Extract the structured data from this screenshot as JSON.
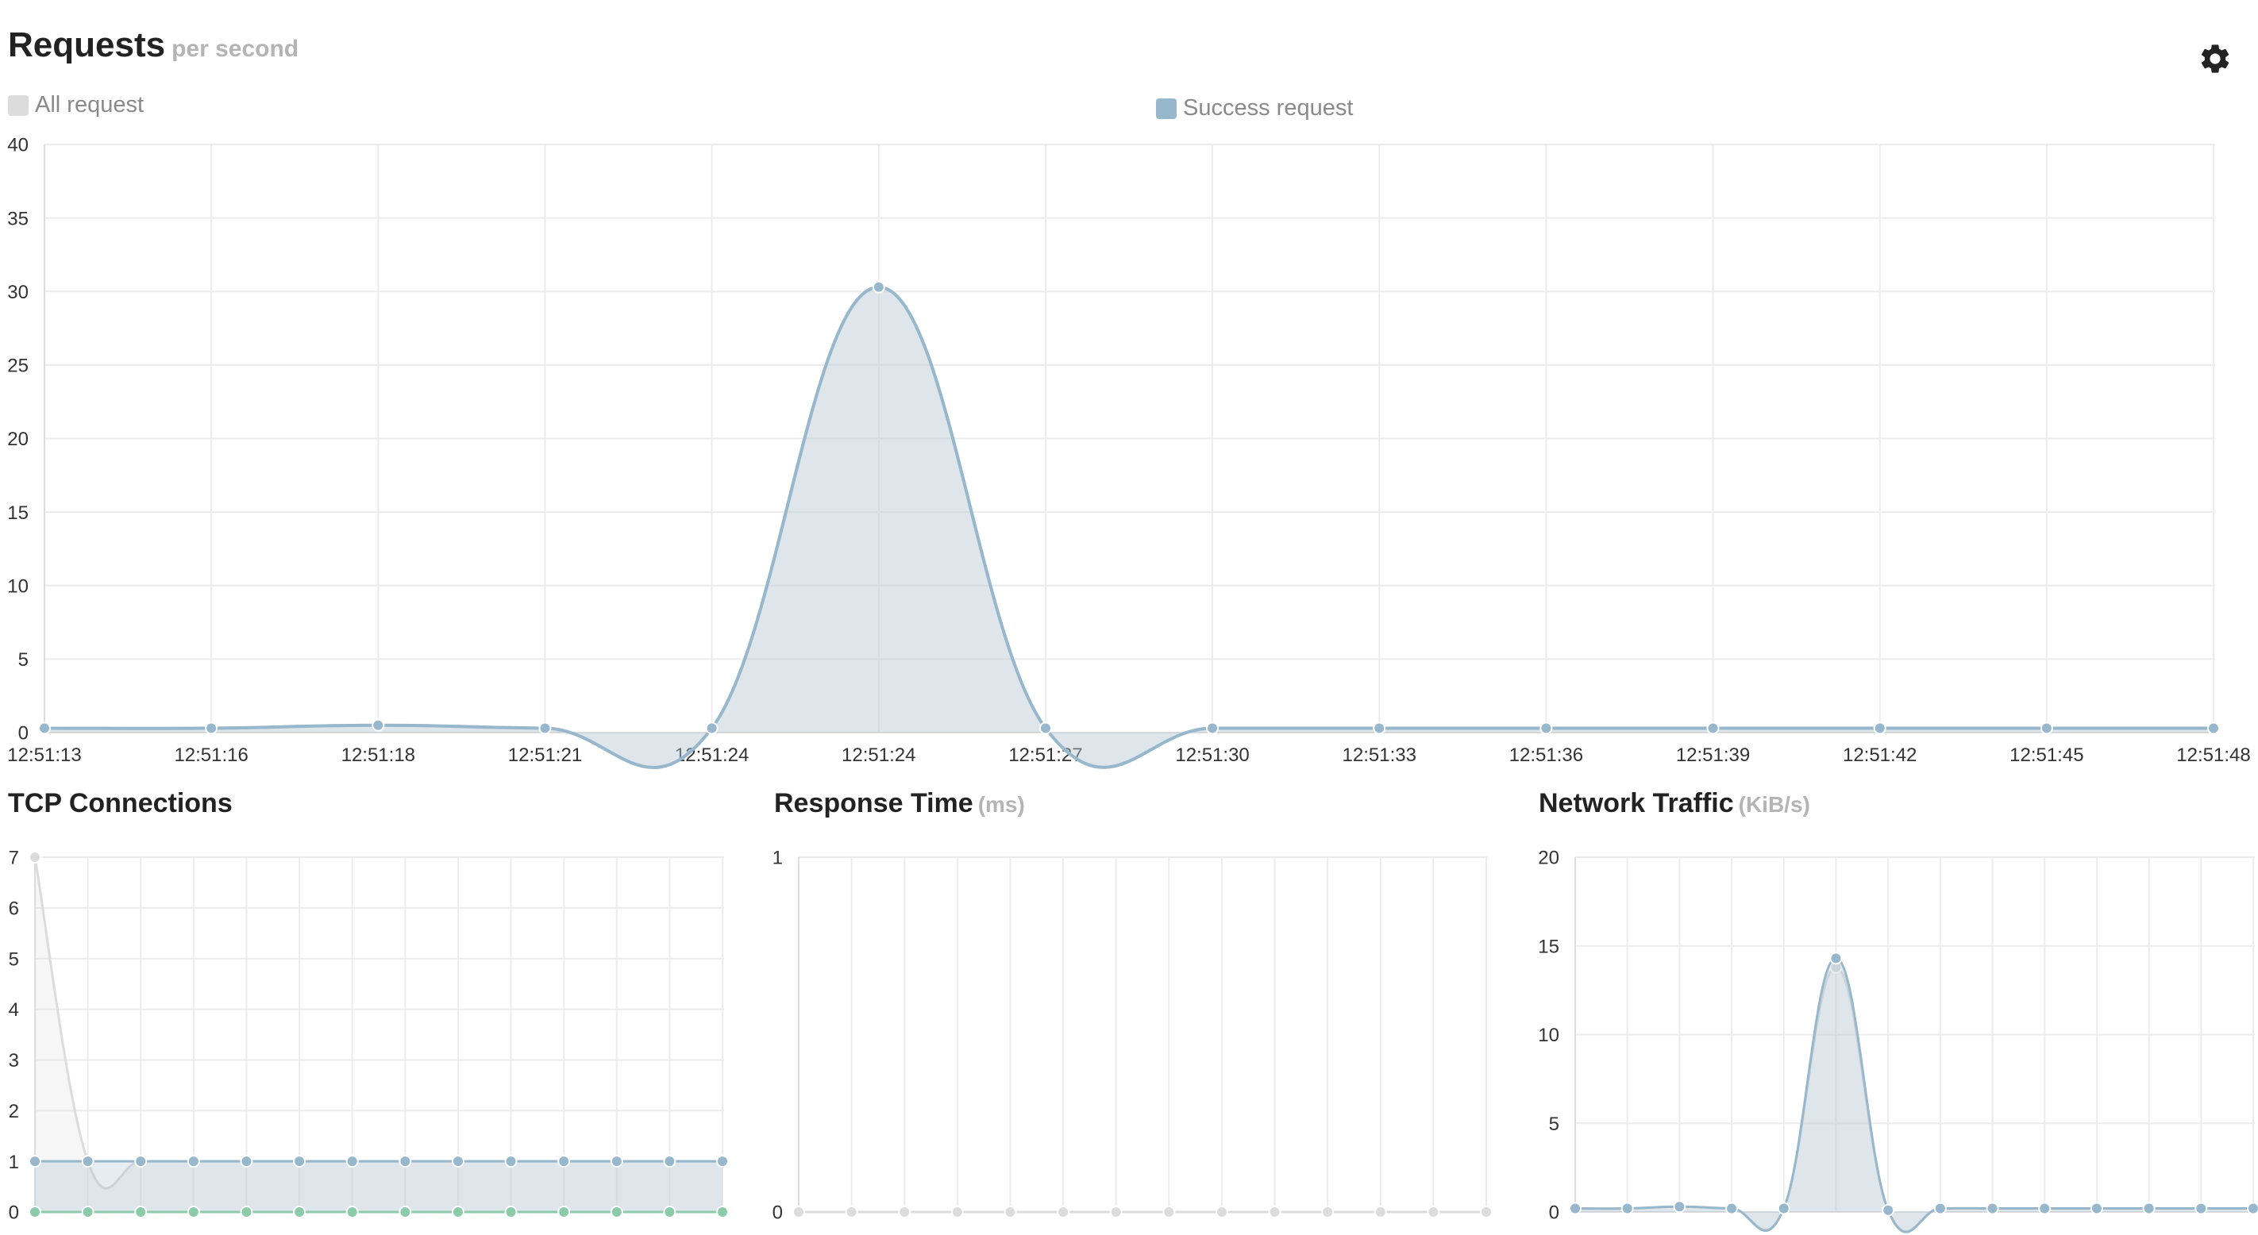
{
  "header": {
    "title": "Requests",
    "unit": "per second"
  },
  "legend": {
    "all": {
      "label": "All request",
      "color": "#dcdcdc"
    },
    "success": {
      "label": "Success request",
      "color": "#97b7cc"
    }
  },
  "settings": {
    "icon": "gear-icon"
  },
  "panels": {
    "tcp": {
      "title": "TCP Connections",
      "unit": ""
    },
    "response": {
      "title": "Response Time",
      "unit": "(ms)"
    },
    "network": {
      "title": "Network Traffic",
      "unit": "(KiB/s)"
    }
  },
  "chart_data": [
    {
      "id": "requests",
      "type": "area",
      "title": "Requests",
      "xlabel": "",
      "ylabel": "",
      "categories": [
        "12:51:13",
        "12:51:16",
        "12:51:18",
        "12:51:21",
        "12:51:24",
        "12:51:24",
        "12:51:27",
        "12:51:30",
        "12:51:33",
        "12:51:36",
        "12:51:39",
        "12:51:42",
        "12:51:45",
        "12:51:48"
      ],
      "ylim": [
        0,
        40
      ],
      "yticks": [
        0,
        5,
        10,
        15,
        20,
        25,
        30,
        35,
        40
      ],
      "grid": true,
      "legend": "top",
      "series": [
        {
          "name": "All request",
          "color": "#dcdcdc",
          "values": [
            0.3,
            0.3,
            0.5,
            0.3,
            0.3,
            30.3,
            0.3,
            0.3,
            0.3,
            0.3,
            0.3,
            0.3,
            0.3,
            0.3
          ]
        },
        {
          "name": "Success request",
          "color": "#97b7cc",
          "values": [
            0.3,
            0.3,
            0.5,
            0.3,
            0.3,
            30.3,
            0.3,
            0.3,
            0.3,
            0.3,
            0.3,
            0.3,
            0.3,
            0.3
          ]
        }
      ]
    },
    {
      "id": "tcp",
      "type": "area",
      "title": "TCP Connections",
      "xlabel": "",
      "ylabel": "",
      "ylim": [
        0,
        7
      ],
      "yticks": [
        0,
        1,
        2,
        3,
        4,
        5,
        6,
        7
      ],
      "grid": true,
      "points": 14,
      "series": [
        {
          "color": "#dcdcdc",
          "values": [
            7,
            1,
            1,
            1,
            1,
            1,
            1,
            1,
            1,
            1,
            1,
            1,
            1,
            1
          ]
        },
        {
          "color": "#97b7cc",
          "values": [
            1,
            1,
            1,
            1,
            1,
            1,
            1,
            1,
            1,
            1,
            1,
            1,
            1,
            1
          ]
        },
        {
          "color": "#8ccbaa",
          "values": [
            0,
            0,
            0,
            0,
            0,
            0,
            0,
            0,
            0,
            0,
            0,
            0,
            0,
            0
          ]
        }
      ]
    },
    {
      "id": "response",
      "type": "line",
      "title": "Response Time",
      "xlabel": "",
      "ylabel": "",
      "ylim": [
        0,
        1
      ],
      "yticks": [
        0,
        1
      ],
      "grid": true,
      "points": 14,
      "series": [
        {
          "color": "#dcdcdc",
          "values": [
            0,
            0,
            0,
            0,
            0,
            0,
            0,
            0,
            0,
            0,
            0,
            0,
            0,
            0
          ]
        }
      ]
    },
    {
      "id": "network",
      "type": "area",
      "title": "Network Traffic",
      "xlabel": "",
      "ylabel": "",
      "ylim": [
        0,
        20
      ],
      "yticks": [
        0,
        5,
        10,
        15,
        20
      ],
      "grid": true,
      "points": 14,
      "series": [
        {
          "color": "#dcdcdc",
          "values": [
            0.2,
            0.2,
            0.3,
            0.2,
            0.2,
            13.8,
            0.1,
            0.2,
            0.2,
            0.2,
            0.2,
            0.2,
            0.2,
            0.2
          ]
        },
        {
          "color": "#97b7cc",
          "values": [
            0.2,
            0.2,
            0.3,
            0.2,
            0.2,
            14.3,
            0.1,
            0.2,
            0.2,
            0.2,
            0.2,
            0.2,
            0.2,
            0.2
          ]
        }
      ]
    }
  ]
}
